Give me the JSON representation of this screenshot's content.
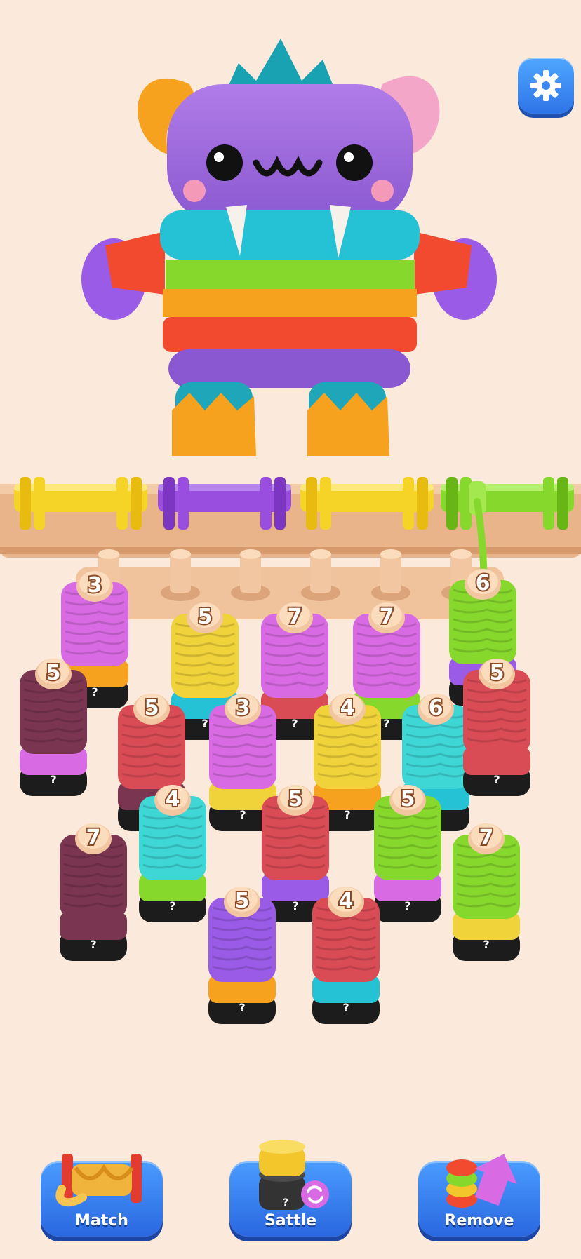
{
  "settings": {
    "icon": "gear-icon"
  },
  "spools": [
    {
      "id": "yellow",
      "color": "#f5d327"
    },
    {
      "id": "purple",
      "color": "#9a4ee0"
    },
    {
      "id": "yellow2",
      "color": "#f5d327"
    },
    {
      "id": "green",
      "color": "#86d82c",
      "active": true
    }
  ],
  "stacks": [
    {
      "count": "3",
      "hidden": "?",
      "top": "#d86be4"
    },
    {
      "count": "5",
      "hidden": "?",
      "top": "#f0d23a"
    },
    {
      "count": "7",
      "hidden": "?",
      "top": "#d86be4"
    },
    {
      "count": "7",
      "hidden": "?",
      "top": "#d86be4"
    },
    {
      "count": "6",
      "hidden": "?",
      "top": "#86d82c"
    },
    {
      "count": "5",
      "hidden": "?",
      "top": "#7a3551"
    },
    {
      "count": "5",
      "hidden": "?",
      "top": "#d94b55"
    },
    {
      "count": "3",
      "hidden": "?",
      "top": "#d86be4"
    },
    {
      "count": "4",
      "hidden": "?",
      "top": "#f0d23a"
    },
    {
      "count": "6",
      "hidden": "?",
      "top": "#3fd6d6"
    },
    {
      "count": "5",
      "hidden": "?",
      "top": "#d94b55"
    },
    {
      "count": "4",
      "hidden": "?",
      "top": "#3fd6d6"
    },
    {
      "count": "5",
      "hidden": "?",
      "top": "#d94b55"
    },
    {
      "count": "5",
      "hidden": "?",
      "top": "#86d82c"
    },
    {
      "count": "7",
      "hidden": "?",
      "top": "#7a3551"
    },
    {
      "count": "7",
      "hidden": "?",
      "top": "#86d82c"
    },
    {
      "count": "5",
      "hidden": "?",
      "top": "#9a5be6"
    },
    {
      "count": "4",
      "hidden": "?",
      "top": "#d94b55"
    }
  ],
  "buttons": {
    "match": "Match",
    "shuffle": "Sattle",
    "remove": "Remove",
    "shuffle_hint": "?"
  }
}
